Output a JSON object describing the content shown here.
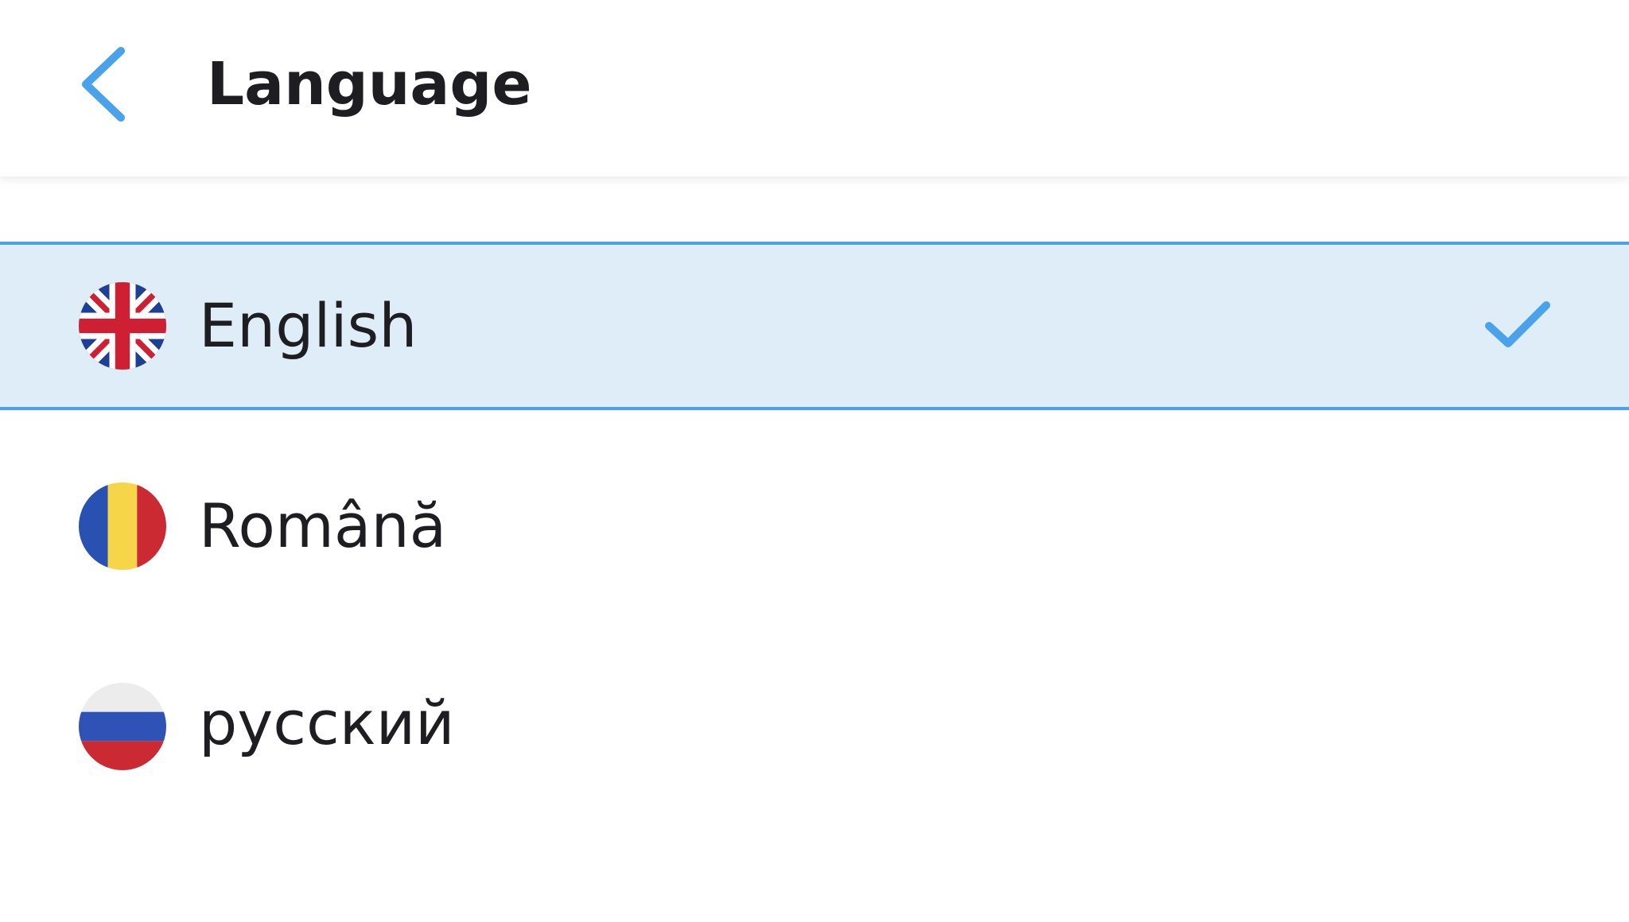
{
  "header": {
    "title": "Language",
    "back_icon": "chevron-left-icon"
  },
  "languages": [
    {
      "label": "English",
      "flag": "uk-flag-icon",
      "selected": true
    },
    {
      "label": "Română",
      "flag": "romania-flag-icon",
      "selected": false
    },
    {
      "label": "русский",
      "flag": "russia-flag-icon",
      "selected": false
    }
  ],
  "colors": {
    "accent": "#4aa3ea",
    "selected_background": "#dfedf8",
    "text": "#1d1d22"
  }
}
